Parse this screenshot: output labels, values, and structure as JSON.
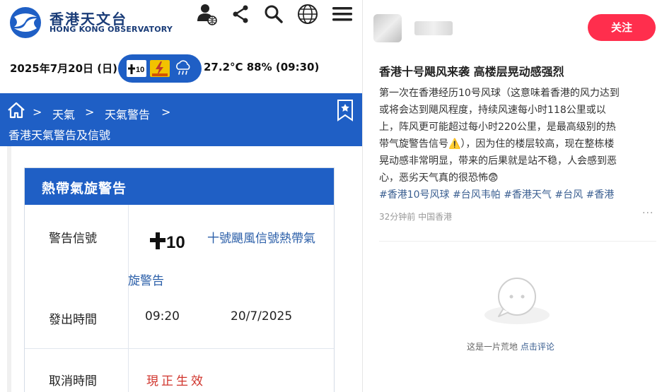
{
  "hko": {
    "logo_zh": "香港天文台",
    "logo_en": "HONG KONG OBSERVATORY",
    "date": "2025年7月20日 (日)",
    "temp_humidity_time": "27.2°C  88%  (09:30)",
    "icons": [
      "user-globe-icon",
      "share-icon",
      "search-icon",
      "globe-icon",
      "menu-icon"
    ],
    "breadcrumb": [
      "天氣",
      "天氣警告"
    ],
    "breadcrumb_sep": ">",
    "page_title": "香港天氣警告及信號",
    "card": {
      "title": "熱帶氣旋警告",
      "signal_label": "警告信號",
      "signal_desc_1": "十號颶風信號熱帶氣",
      "signal_desc_2": "旋警告",
      "issue_label": "發出時間",
      "issue_time": "09:20",
      "issue_date": "20/7/2025",
      "cancel_label": "取消時間",
      "cancel_value": "現正生效"
    },
    "colors": {
      "brand_blue": "#1f5fc5",
      "active_red": "#d0342c"
    }
  },
  "post": {
    "follow_label": "关注",
    "title": "香港十号飓风来袭 高楼层晃动感强烈",
    "body_lines": [
      "第一次在香港经历10号风球（这意味着香港的风力达到",
      "或将会达到飓风程度，持续风速每小时118公里或以",
      "上，阵风更可能超过每小时220公里，是最高级别的热",
      "带气旋警告信号⚠️），因为住的楼层较高，现在整栋楼",
      "晃动感非常明显，带来的后果就是站不稳，人会感到恶",
      "心，恶劣天气真的很恐怖😨"
    ],
    "tags": [
      "#香港10号风球",
      "#台风韦帕",
      "#香港天气",
      "#台风",
      "#香港"
    ],
    "meta": "32分钟前 中国香港",
    "more": "···",
    "empty_text": "这是一片荒地",
    "empty_link": "点击评论",
    "colors": {
      "follow": "#ff2e4d",
      "tag": "#3b5f91"
    }
  }
}
